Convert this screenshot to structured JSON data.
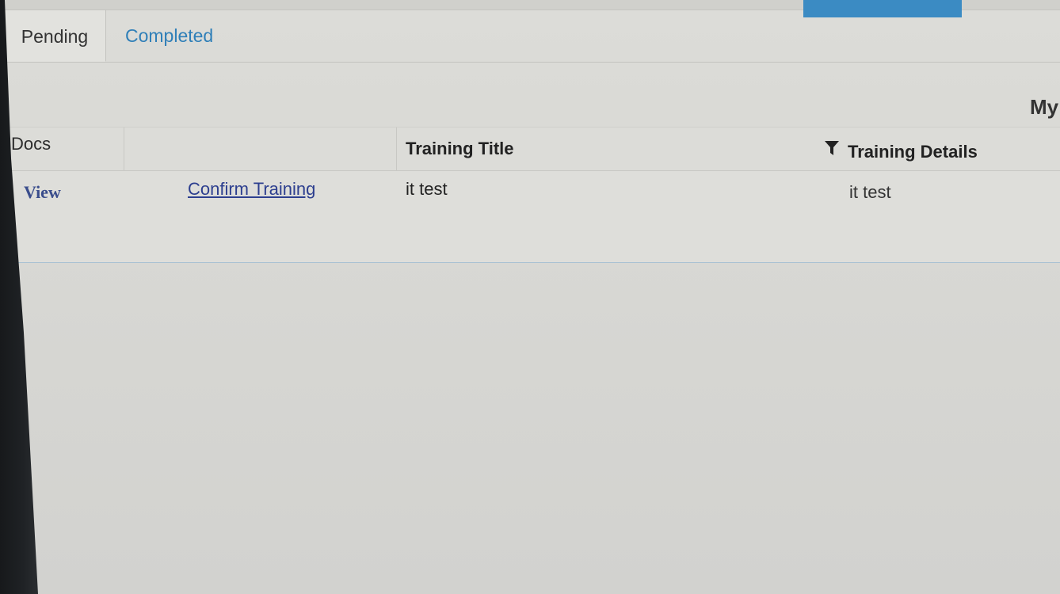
{
  "tabs": [
    {
      "label": "Pending",
      "active": true
    },
    {
      "label": "Completed",
      "active": false
    }
  ],
  "page_heading_partial": "My",
  "table": {
    "headers": {
      "docs": "Docs",
      "action": "",
      "training_title": "Training Title",
      "training_details": "Training Details"
    },
    "rows": [
      {
        "docs_link": "View",
        "action_link": "Confirm Training",
        "training_title": "it test",
        "training_details": "it test"
      }
    ]
  },
  "icons": {
    "training_details_filter": "filter-icon"
  },
  "colors": {
    "accent_blue": "#3b8bc3",
    "link_blue": "#2d3f8f",
    "tab_link": "#2f7fb8"
  }
}
